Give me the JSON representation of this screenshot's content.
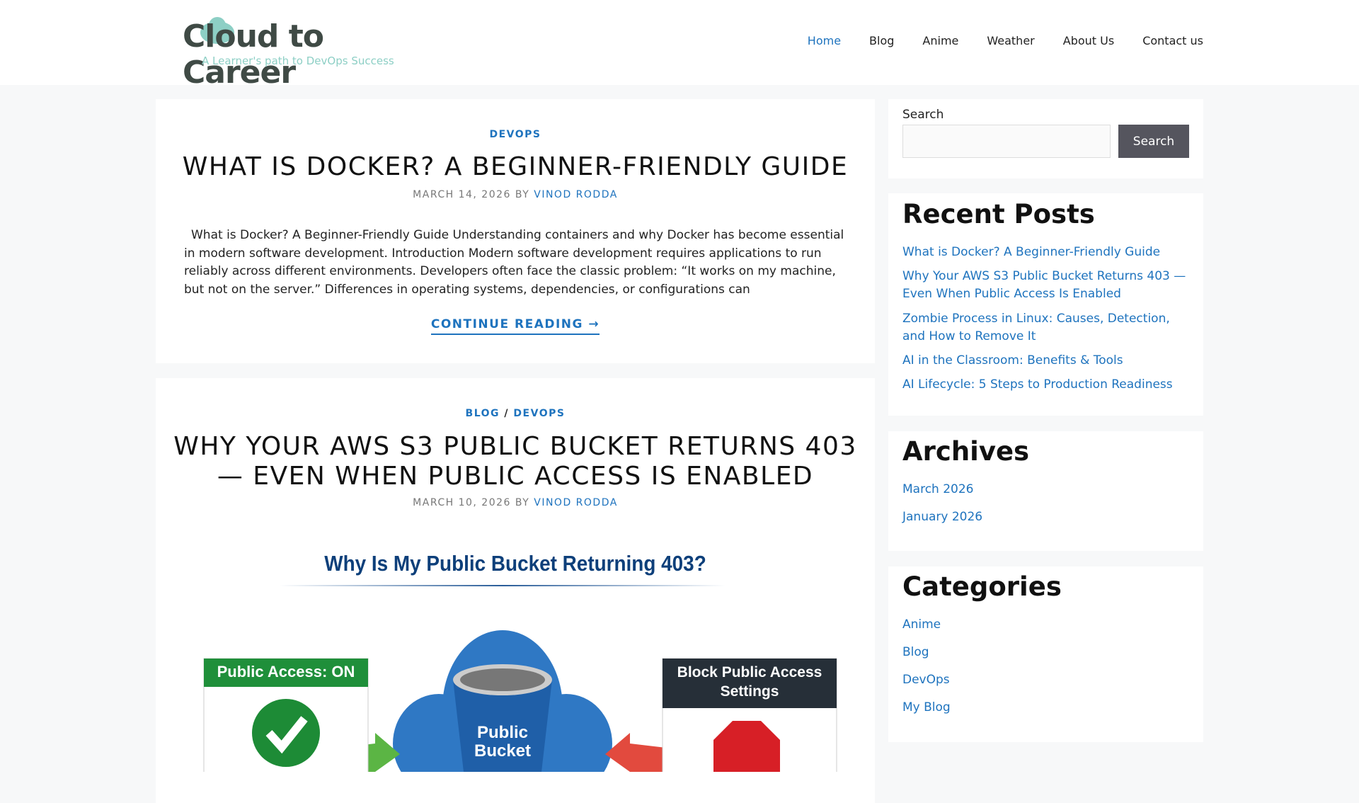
{
  "logo": {
    "name": "Cloud to Career",
    "tagline": "A Learner's path to DevOps Success"
  },
  "nav": [
    "Home",
    "Blog",
    "Anime",
    "Weather",
    "About Us",
    "Contact us"
  ],
  "posts": [
    {
      "categories": [
        "DEVOPS"
      ],
      "title": "WHAT IS DOCKER? A BEGINNER-FRIENDLY GUIDE",
      "date": "MARCH 14, 2026",
      "by": "BY",
      "author": "VINOD RODDA",
      "excerpt": "What is Docker? A Beginner-Friendly Guide Understanding containers and why Docker has become essential in modern software development. Introduction Modern software development requires applications to run reliably across different environments. Developers often face the classic problem: “It works on my machine, but not on the server.” Differences in operating systems, dependencies, or configurations can",
      "more": "CONTINUE READING →"
    },
    {
      "categories": [
        "BLOG",
        "DEVOPS"
      ],
      "sep": "/",
      "title_lines": [
        "WHY YOUR AWS S3 PUBLIC BUCKET RETURNS 403",
        "— EVEN WHEN PUBLIC ACCESS IS ENABLED"
      ],
      "date": "MARCH 10, 2026",
      "by": "BY",
      "author": "VINOD RODDA",
      "image": {
        "heading": "Why Is My Public Bucket Returning 403?",
        "left_label": "Public Access: ON",
        "center_label_1": "Public",
        "center_label_2": "Bucket",
        "right_label_1": "Block Public Access",
        "right_label_2": "Settings"
      }
    }
  ],
  "search": {
    "label": "Search",
    "button": "Search",
    "value": ""
  },
  "recent": {
    "heading": "Recent Posts",
    "items": [
      "What is Docker? A Beginner-Friendly Guide",
      "Why Your AWS S3 Public Bucket Returns 403 —",
      "Even When Public Access Is Enabled",
      "Zombie Process in Linux: Causes, Detection,",
      "and How to Remove It",
      "AI in the Classroom: Benefits & Tools",
      "AI Lifecycle: 5 Steps to Production Readiness"
    ]
  },
  "archives": {
    "heading": "Archives",
    "items": [
      "March 2026",
      "January 2026"
    ]
  },
  "categories": {
    "heading": "Categories",
    "items": [
      "Anime",
      "Blog",
      "DevOps",
      "My Blog"
    ]
  }
}
